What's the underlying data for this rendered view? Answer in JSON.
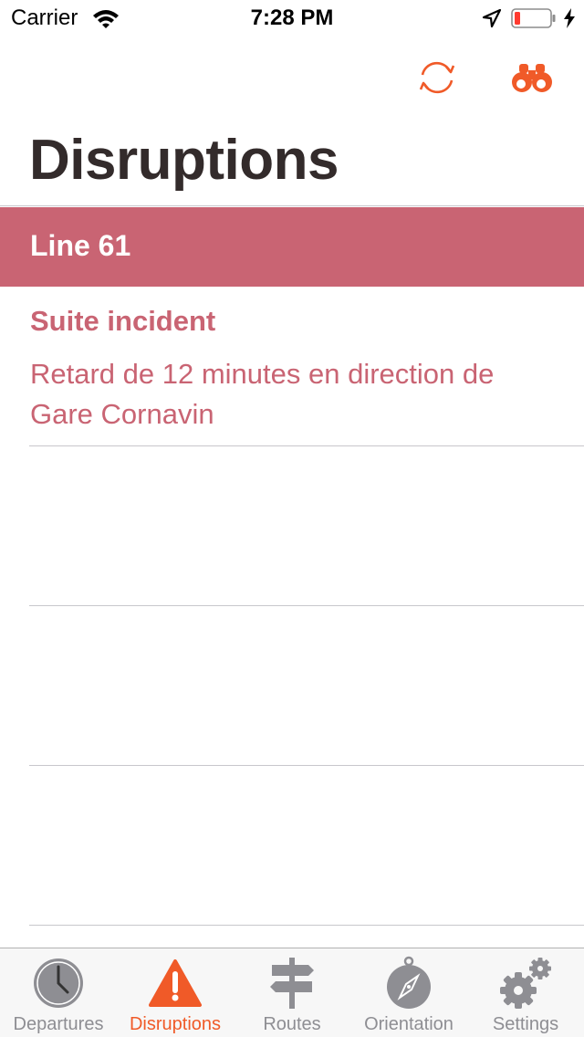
{
  "status_bar": {
    "carrier": "Carrier",
    "time": "7:28 PM",
    "icons": [
      "wifi-icon",
      "location-arrow-icon",
      "battery-low-icon",
      "charging-bolt-icon"
    ]
  },
  "nav": {
    "title": "Disruptions",
    "actions": [
      "refresh-icon",
      "binoculars-icon"
    ]
  },
  "section": {
    "title": "Line 61"
  },
  "disruption": {
    "title": "Suite incident",
    "description": "Retard de 12 minutes en direction de Gare Cornavin"
  },
  "tab_bar": {
    "active": "Disruptions",
    "items": [
      {
        "label": "Departures",
        "icon": "clock-icon"
      },
      {
        "label": "Disruptions",
        "icon": "warning-icon"
      },
      {
        "label": "Routes",
        "icon": "signpost-icon"
      },
      {
        "label": "Orientation",
        "icon": "compass-icon"
      },
      {
        "label": "Settings",
        "icon": "gears-icon"
      }
    ]
  },
  "colors": {
    "accent": "#f05a28",
    "line_header": "#c96473",
    "disruption_text": "#c96473",
    "title": "#332b2b",
    "tab_inactive": "#8e8e93"
  }
}
